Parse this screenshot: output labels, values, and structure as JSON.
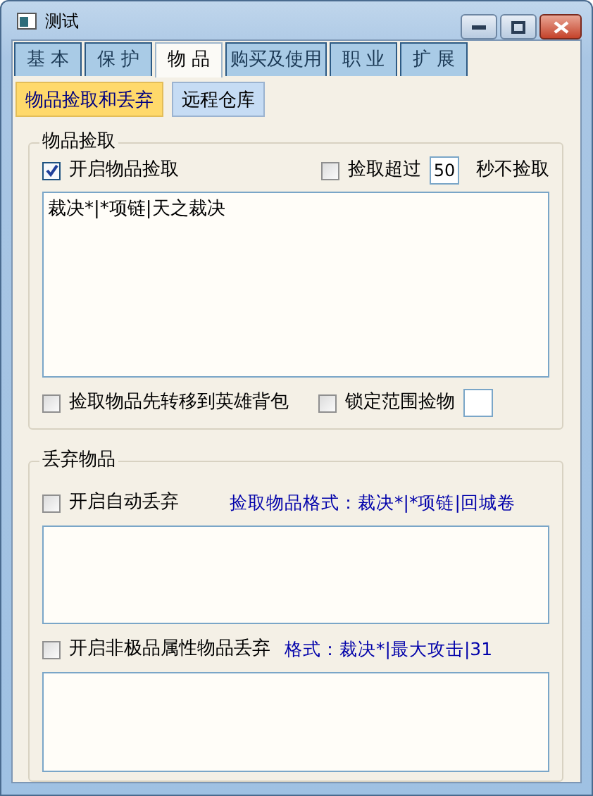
{
  "window": {
    "title": "测试"
  },
  "tabs": [
    {
      "label": "基 本",
      "selected": false
    },
    {
      "label": "保 护",
      "selected": false
    },
    {
      "label": "物 品",
      "selected": true
    },
    {
      "label": "购买及使用",
      "selected": false
    },
    {
      "label": "职 业",
      "selected": false
    },
    {
      "label": "扩 展",
      "selected": false
    }
  ],
  "subtabs": [
    {
      "label": "物品捡取和丢弃",
      "selected": true
    },
    {
      "label": "远程仓库",
      "selected": false
    }
  ],
  "pickup": {
    "title": "物品捡取",
    "enable": {
      "label": "开启物品捡取",
      "checked": true
    },
    "timeout": {
      "label": "捡取超过",
      "checked": false,
      "value": "50",
      "suffix": "秒不捡取"
    },
    "list_value": "裁决*|*项链|天之裁决",
    "to_hero_bag": {
      "label": "捡取物品先转移到英雄背包",
      "checked": false
    },
    "lock_range": {
      "label": "锁定范围捡物",
      "checked": false
    }
  },
  "discard": {
    "title": "丢弃物品",
    "auto": {
      "label": "开启自动丢弃",
      "checked": false,
      "hint": "捡取物品格式：裁决*|*项链|回城卷"
    },
    "non_extreme": {
      "label": "开启非极品属性物品丢弃",
      "checked": false,
      "hint": "格式：裁决*|最大攻击|31"
    }
  }
}
